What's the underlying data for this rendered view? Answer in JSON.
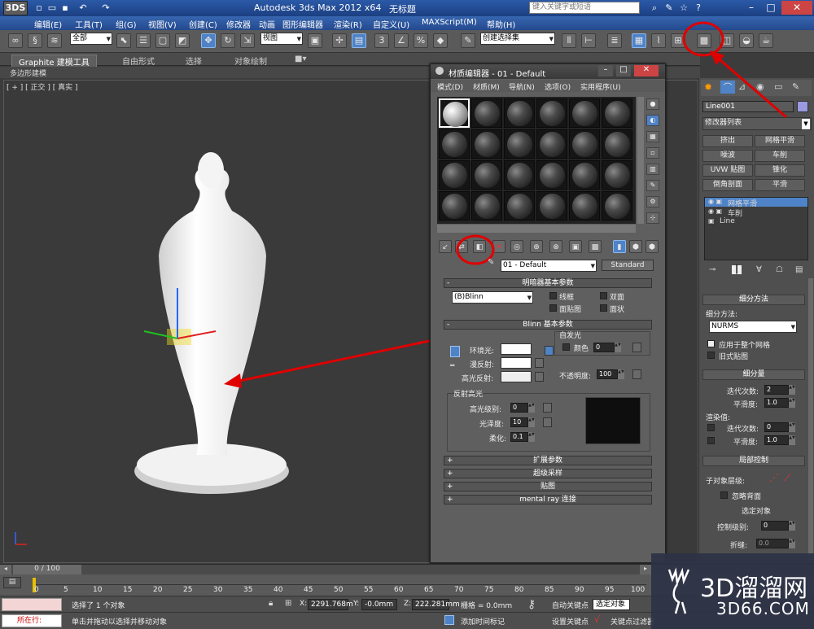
{
  "titlebar": {
    "app_name": "Autodesk 3ds Max  2012 x64",
    "doc_name": "无标题",
    "search_placeholder": "键入关键字或短语",
    "logo": "3DS"
  },
  "menu": [
    "编辑(E)",
    "工具(T)",
    "组(G)",
    "视图(V)",
    "创建(C)",
    "修改器",
    "动画",
    "图形编辑器",
    "渲染(R)",
    "自定义(U)",
    "MAXScript(M)",
    "帮助(H)"
  ],
  "toolbar": {
    "selection_filter": "全部",
    "ref_coord": "视图",
    "named_selection": "创建选择集"
  },
  "ribbon": {
    "tabs": [
      "Graphite 建模工具",
      "自由形式",
      "选择",
      "对象绘制"
    ],
    "sub_label": "多边形建模"
  },
  "viewport": {
    "label": "[ + ] [ 正交 ] [ 真实 ]"
  },
  "material_editor": {
    "title": "材质编辑器 - 01 - Default",
    "menu": [
      "模式(D)",
      "材质(M)",
      "导航(N)",
      "选项(O)",
      "实用程序(U)"
    ],
    "material_name": "01 - Default",
    "material_type": "Standard",
    "shader_rollout": "明暗器基本参数",
    "shader": "(B)Blinn",
    "shader_options": [
      "线框",
      "双面",
      "面贴图",
      "面状"
    ],
    "blinn_rollout": "Blinn 基本参数",
    "self_illum_label": "自发光",
    "color_label": "颜色",
    "self_illum_value": "0",
    "ambient_label": "环境光:",
    "diffuse_label": "漫反射:",
    "specular_label": "高光反射:",
    "opacity_label": "不透明度:",
    "opacity_value": "100",
    "highlight_group": "反射高光",
    "spec_level_label": "高光级别:",
    "spec_level_value": "0",
    "gloss_label": "光泽度:",
    "gloss_value": "10",
    "soften_label": "柔化:",
    "soften_value": "0.1",
    "rollouts": [
      "扩展参数",
      "超级采样",
      "贴图",
      "mental ray 连接"
    ]
  },
  "command_panel": {
    "object_name": "Line001",
    "modifier_list": "修改器列表",
    "modifier_buttons": [
      "挤出",
      "网格平滑",
      "噪波",
      "车削",
      "UVW 贴图",
      "锥化",
      "倒角剖面",
      "平滑"
    ],
    "stack": [
      "网格平滑",
      "车削",
      "Line"
    ],
    "subdiv_method_title": "细分方法",
    "subdiv_method_label": "细分方法:",
    "subdiv_method_value": "NURMS",
    "apply_whole_mesh": "应用于整个网格",
    "old_style_mapping": "旧式贴图",
    "subdiv_amount_title": "细分量",
    "iterations_label": "迭代次数:",
    "iterations_value": "2",
    "smoothness_label": "平滑度:",
    "smoothness_value": "1.0",
    "render_values_label": "渲染值:",
    "render_iterations_value": "0",
    "render_smoothness_value": "1.0",
    "local_control_title": "局部控制",
    "sub_object_label": "子对象层级:",
    "ignore_backface": "忽略背面",
    "selected_object": "选定对象",
    "control_level_label": "控制级别:",
    "control_level_value": "0",
    "crease_label": "折缝:",
    "crease_value": "0.0"
  },
  "timeline": {
    "frame": "0 / 100",
    "ticks": [
      "0",
      "5",
      "10",
      "15",
      "20",
      "25",
      "30",
      "35",
      "40",
      "45",
      "50",
      "55",
      "60",
      "65",
      "70",
      "75",
      "80",
      "85",
      "90",
      "95",
      "100"
    ]
  },
  "status": {
    "selected": "选择了 1 个对象",
    "prompt": "单击并拖动以选择并移动对象",
    "x_label": "X:",
    "x_value": "2291.768m",
    "y_label": "Y:",
    "y_value": "-0.0mm",
    "z_label": "Z:",
    "z_value": "222.281mm",
    "grid": "栅格 = 0.0mm",
    "auto_key": "自动关键点",
    "set_key": "设置关键点",
    "key_filter_sel": "选定对象",
    "key_filters": "关键点过滤器",
    "add_time_tag": "添加时间标记",
    "listener": "所在行:"
  },
  "watermark": {
    "big": "3D溜溜网",
    "small": "3D66.COM"
  },
  "colors": {
    "annotation_red": "#e00000",
    "selection_blue": "#4f83c7"
  }
}
